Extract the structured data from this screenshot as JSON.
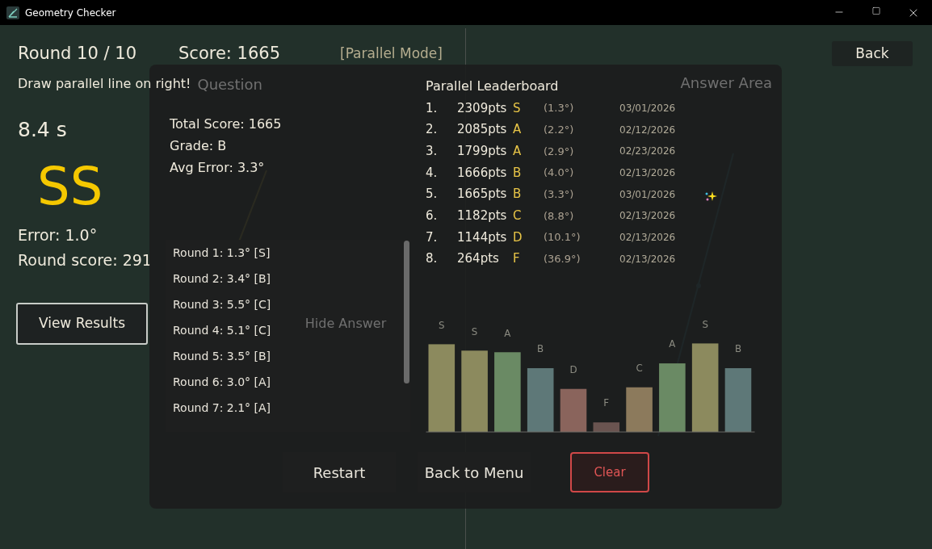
{
  "window": {
    "title": "Geometry Checker"
  },
  "header": {
    "round": "Round 10 / 10",
    "score": "Score: 1665",
    "mode": "[Parallel Mode]",
    "back_button": "Back"
  },
  "question": {
    "instruction": "Draw parallel line on right!",
    "heading": "Question",
    "timer": "8.4 s",
    "grade": "SS",
    "error": "Error: 1.0°",
    "round_score": "Round score: 291",
    "view_results_button": "View Results",
    "hide_answer_button": "Hide Answer"
  },
  "answer": {
    "heading": "Answer Area"
  },
  "results": {
    "total_score": "Total Score: 1665",
    "grade": "Grade: B",
    "avg_error": "Avg Error: 3.3°",
    "rounds": [
      "Round 1: 1.3° [S]",
      "Round 2: 3.4° [B]",
      "Round 3: 5.5° [C]",
      "Round 4: 5.1° [C]",
      "Round 5: 3.5° [B]",
      "Round 6: 3.0° [A]",
      "Round 7: 2.1° [A]"
    ],
    "leaderboard": {
      "title": "Parallel Leaderboard",
      "entries": [
        {
          "rank": "1.",
          "points": "2309pts",
          "grade": "S",
          "error": "(1.3°)",
          "date": "03/01/2026"
        },
        {
          "rank": "2.",
          "points": "2085pts",
          "grade": "A",
          "error": "(2.2°)",
          "date": "02/12/2026"
        },
        {
          "rank": "3.",
          "points": "1799pts",
          "grade": "A",
          "error": "(2.9°)",
          "date": "02/23/2026"
        },
        {
          "rank": "4.",
          "points": "1666pts",
          "grade": "B",
          "error": "(4.0°)",
          "date": "02/13/2026"
        },
        {
          "rank": "5.",
          "points": "1665pts",
          "grade": "B",
          "error": "(3.3°)",
          "date": "03/01/2026"
        },
        {
          "rank": "6.",
          "points": "1182pts",
          "grade": "C",
          "error": "(8.8°)",
          "date": "02/13/2026"
        },
        {
          "rank": "7.",
          "points": "1144pts",
          "grade": "D",
          "error": "(10.1°)",
          "date": "02/13/2026"
        },
        {
          "rank": "8.",
          "points": "264pts",
          "grade": "F",
          "error": "(36.9°)",
          "date": "02/13/2026"
        }
      ]
    },
    "grade_bars": [
      {
        "label": "S",
        "color": "#8c8a5e"
      },
      {
        "label": "S",
        "color": "#8c8a5e"
      },
      {
        "label": "A",
        "color": "#6a8a64"
      },
      {
        "label": "B",
        "color": "#5e7878"
      },
      {
        "label": "D",
        "color": "#8a645c"
      },
      {
        "label": "F",
        "color": "#6a5450"
      },
      {
        "label": "C",
        "color": "#8c7a5c"
      },
      {
        "label": "A",
        "color": "#6a8a64"
      },
      {
        "label": "S",
        "color": "#8c8a5e"
      },
      {
        "label": "B",
        "color": "#5e7878"
      }
    ],
    "buttons": [
      {
        "label": "Restart",
        "kind": "plain"
      },
      {
        "label": "Back to Menu",
        "kind": "plain"
      },
      {
        "label": "Clear",
        "kind": "danger"
      }
    ]
  }
}
